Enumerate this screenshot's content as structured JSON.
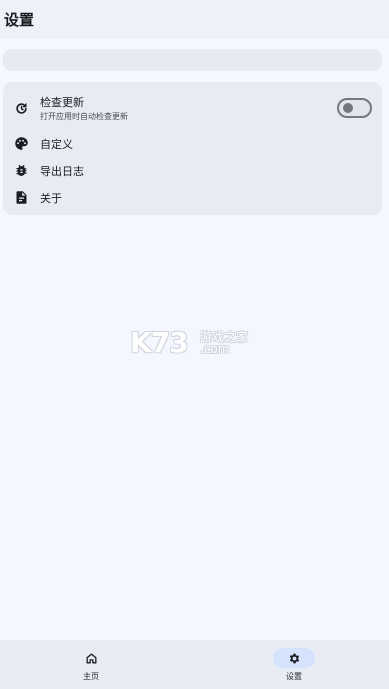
{
  "header": {
    "title": "设置"
  },
  "settings": {
    "check_update": {
      "label": "检查更新",
      "description": "打开应用时自动检查更新",
      "icon": "update-icon",
      "enabled": false
    },
    "customize": {
      "label": "自定义",
      "icon": "palette-icon"
    },
    "export_log": {
      "label": "导出日志",
      "icon": "bug-icon"
    },
    "about": {
      "label": "关于",
      "icon": "document-info-icon"
    }
  },
  "watermark": {
    "logo_text": "K73",
    "cn_text": "游戏之家",
    "com_text": ".com"
  },
  "bottom_nav": {
    "items": [
      {
        "label": "主页",
        "icon": "home-icon",
        "active": false
      },
      {
        "label": "设置",
        "icon": "gear-icon",
        "active": true
      }
    ]
  },
  "colors": {
    "background": "#f4f7ff",
    "card": "#e8ebf3",
    "active_pill": "#d5e2fb",
    "icon": "#1b1c22"
  }
}
